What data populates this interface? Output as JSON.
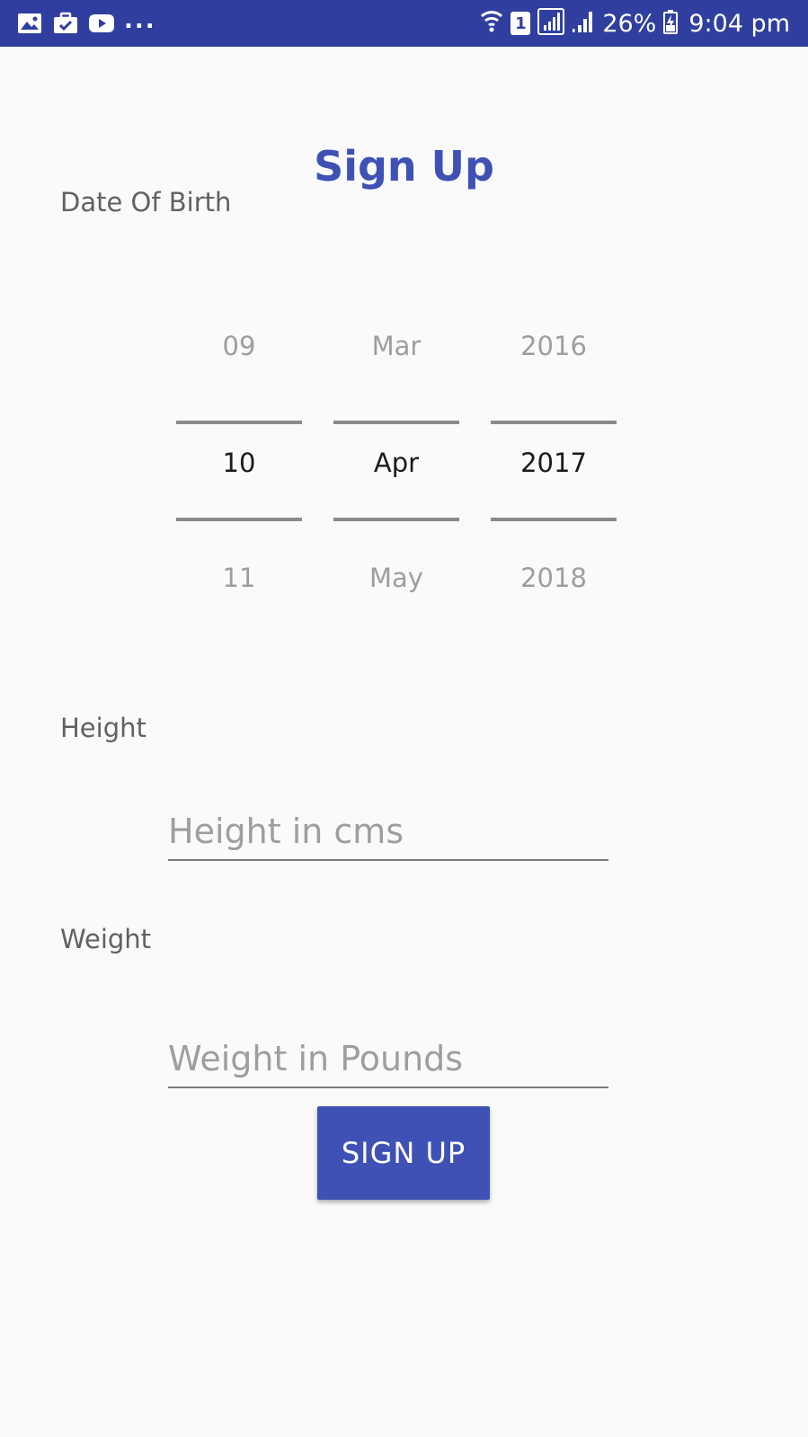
{
  "status_bar": {
    "icons_left": [
      "image-icon",
      "briefcase-check-icon",
      "youtube-icon"
    ],
    "overflow": "...",
    "sim_slot": "1",
    "battery": "26%",
    "time": "9:04 pm"
  },
  "title": "Sign Up",
  "dob": {
    "label": "Date Of Birth",
    "day": {
      "prev": "09",
      "current": "10",
      "next": "11"
    },
    "month": {
      "prev": "Mar",
      "current": "Apr",
      "next": "May"
    },
    "year": {
      "prev": "2016",
      "current": "2017",
      "next": "2018"
    }
  },
  "height": {
    "label": "Height",
    "placeholder": "Height in cms"
  },
  "weight": {
    "label": "Weight",
    "placeholder": "Weight in Pounds"
  },
  "signup_button": "SIGN UP",
  "colors": {
    "status_bar": "#303f9f",
    "primary": "#3f51b5",
    "background": "#fafafa"
  }
}
